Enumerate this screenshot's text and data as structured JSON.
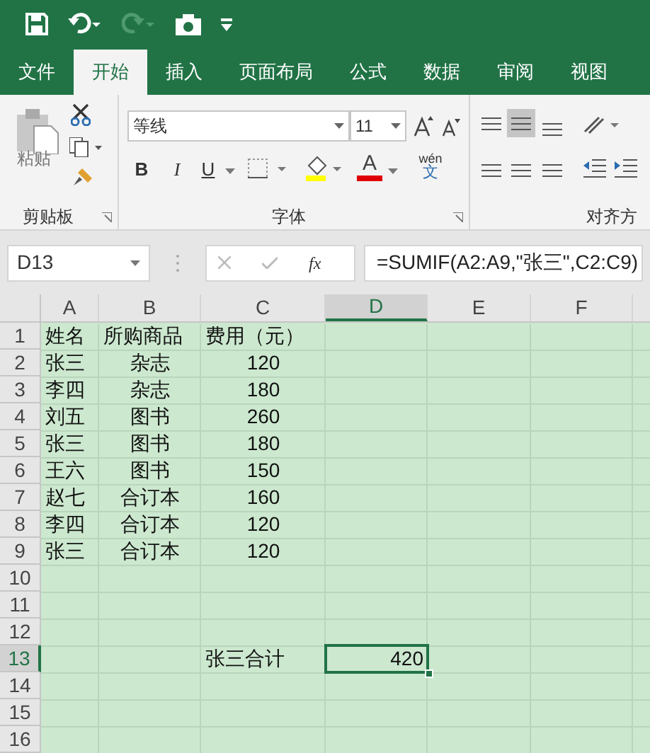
{
  "quick_access": [
    {
      "kind": "save",
      "disabled": false
    },
    {
      "kind": "undo",
      "disabled": false
    },
    {
      "kind": "redo",
      "disabled": true
    },
    {
      "kind": "camera",
      "disabled": false
    },
    {
      "kind": "customize",
      "disabled": false
    }
  ],
  "tabs": [
    {
      "label": "文件",
      "selected": false
    },
    {
      "label": "开始",
      "selected": true
    },
    {
      "label": "插入",
      "selected": false
    },
    {
      "label": "页面布局",
      "selected": false
    },
    {
      "label": "公式",
      "selected": false
    },
    {
      "label": "数据",
      "selected": false
    },
    {
      "label": "审阅",
      "selected": false
    },
    {
      "label": "视图",
      "selected": false
    }
  ],
  "ribbon": {
    "clipboard": {
      "paste_label": "粘贴",
      "group_label": "剪贴板"
    },
    "font": {
      "font_name": "等线",
      "font_size": "11",
      "bold": "B",
      "italic": "I",
      "underline": "U",
      "font_color": "A",
      "phonetic_top": "wén",
      "phonetic_bottom": "文",
      "group_label": "字体"
    },
    "alignment": {
      "group_label": "对齐方",
      "middle_align_selected": true
    }
  },
  "formula_bar": {
    "name_box": "D13",
    "fx": "fx",
    "formula": "=SUMIF(A2:A9,\"张三\",C2:C9)"
  },
  "columns": [
    {
      "label": "A",
      "selected": false
    },
    {
      "label": "B",
      "selected": false
    },
    {
      "label": "C",
      "selected": false
    },
    {
      "label": "D",
      "selected": true
    },
    {
      "label": "E",
      "selected": false
    },
    {
      "label": "F",
      "selected": false
    }
  ],
  "rows": [
    {
      "number": "1",
      "selected": false,
      "cells": {
        "A": "姓名",
        "B": "所购商品",
        "C": "费用（元）"
      }
    },
    {
      "number": "2",
      "selected": false,
      "cells": {
        "A": "张三",
        "B": "杂志",
        "C": "120"
      }
    },
    {
      "number": "3",
      "selected": false,
      "cells": {
        "A": "李四",
        "B": "杂志",
        "C": "180"
      }
    },
    {
      "number": "4",
      "selected": false,
      "cells": {
        "A": "刘五",
        "B": "图书",
        "C": "260"
      }
    },
    {
      "number": "5",
      "selected": false,
      "cells": {
        "A": "张三",
        "B": "图书",
        "C": "180"
      }
    },
    {
      "number": "6",
      "selected": false,
      "cells": {
        "A": "王六",
        "B": "图书",
        "C": "150"
      }
    },
    {
      "number": "7",
      "selected": false,
      "cells": {
        "A": "赵七",
        "B": "合订本",
        "C": "160"
      }
    },
    {
      "number": "8",
      "selected": false,
      "cells": {
        "A": "李四",
        "B": "合订本",
        "C": "120"
      }
    },
    {
      "number": "9",
      "selected": false,
      "cells": {
        "A": "张三",
        "B": "合订本",
        "C": "120"
      }
    },
    {
      "number": "10",
      "selected": false,
      "cells": {}
    },
    {
      "number": "11",
      "selected": false,
      "cells": {}
    },
    {
      "number": "12",
      "selected": false,
      "cells": {}
    },
    {
      "number": "13",
      "selected": true,
      "cells": {
        "C": "张三合计",
        "D": "420"
      }
    },
    {
      "number": "14",
      "selected": false,
      "cells": {}
    },
    {
      "number": "15",
      "selected": false,
      "cells": {}
    },
    {
      "number": "16",
      "selected": false,
      "cells": {}
    }
  ]
}
